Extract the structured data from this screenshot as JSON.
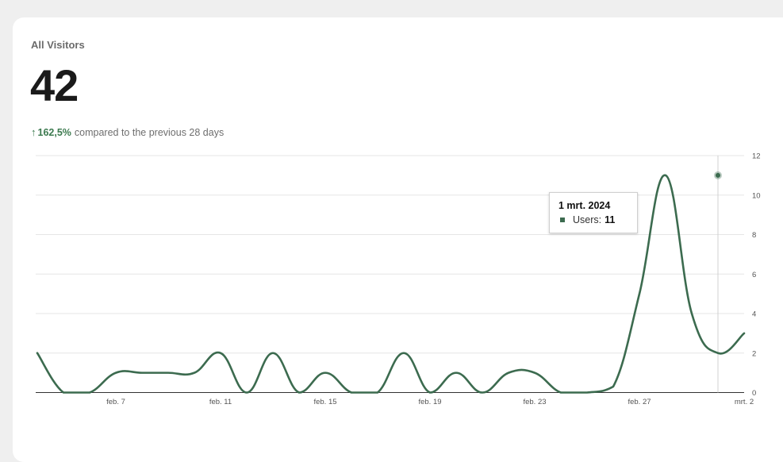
{
  "card": {
    "title": "All Visitors",
    "total": "42",
    "change_arrow": "↑",
    "change_pct": "162,5%",
    "change_text": "compared to the previous 28 days"
  },
  "tooltip": {
    "date": "1 mrt. 2024",
    "series_label": "Users:",
    "value": "11"
  },
  "colors": {
    "line": "#3c6b4f",
    "accent_green": "#3c7a4f",
    "grid": "#e6e6e6"
  },
  "chart_data": {
    "type": "line",
    "x": [
      "feb. 4",
      "feb. 5",
      "feb. 6",
      "feb. 7",
      "feb. 8",
      "feb. 9",
      "feb. 10",
      "feb. 11",
      "feb. 12",
      "feb. 13",
      "feb. 14",
      "feb. 15",
      "feb. 16",
      "feb. 17",
      "feb. 18",
      "feb. 19",
      "feb. 20",
      "feb. 21",
      "feb. 22",
      "feb. 23",
      "feb. 24",
      "feb. 25",
      "feb. 26",
      "feb. 27",
      "feb. 28",
      "feb. 29",
      "mrt. 1",
      "mrt. 2",
      "mrt. 3"
    ],
    "series": [
      {
        "values": [
          2,
          0,
          0,
          1,
          1,
          1,
          1,
          2,
          0,
          2,
          0,
          1,
          0,
          0,
          2,
          0,
          1,
          0,
          1,
          1,
          0,
          0,
          0.3,
          5,
          11,
          4,
          2,
          3
        ]
      }
    ],
    "x_tick_labels": [
      "feb. 7",
      "feb. 11",
      "feb. 15",
      "feb. 19",
      "feb. 23",
      "feb. 27",
      "mrt. 2"
    ],
    "y_ticks": [
      "0",
      "2",
      "4",
      "6",
      "8",
      "10",
      "12"
    ],
    "ylim": [
      0,
      12
    ],
    "grid": true,
    "highlight": {
      "x": "mrt. 1",
      "value": 11
    }
  }
}
